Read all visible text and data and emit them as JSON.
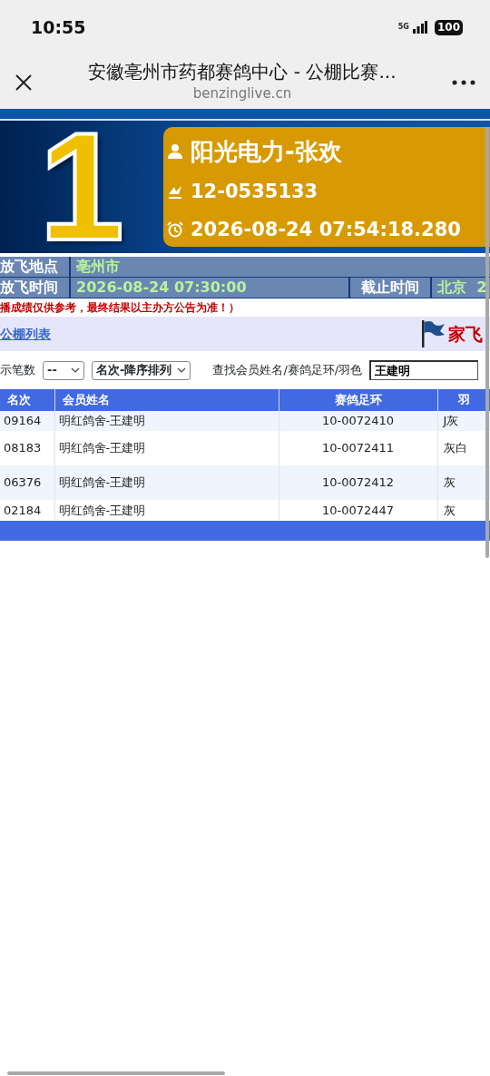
{
  "status_bar": {
    "time": "10:55",
    "network": "5G",
    "battery": "100"
  },
  "browser": {
    "title": "安徽亳州市药都赛鸽中心 - 公棚比赛...",
    "url": "benzinglive.cn"
  },
  "hero": {
    "rank": "1",
    "name": "阳光电力-张欢",
    "ring": "12-0535133",
    "time": "2026-08-24 07:54:18.280"
  },
  "info": {
    "place_label": "放飞地点",
    "place": "亳州市",
    "time_label": "放飞时间",
    "time": "2026-08-24 07:30:00",
    "deadline_label": "截止时间",
    "deadline": "北京  2"
  },
  "notice": "播成绩仅供参考，最终结果以主办方公告为准！）",
  "nav": {
    "link": "公棚列表",
    "title": "家飞"
  },
  "filters": {
    "count_label": "示笔数",
    "count_value": "--",
    "sort_value": "名次-降序排列",
    "search_label": "查找会员姓名/赛鸽足环/羽色",
    "search_value": "王建明"
  },
  "table": {
    "columns": [
      "名次",
      "会员姓名",
      "赛鸽足环",
      "羽"
    ],
    "rows": [
      [
        "09164",
        "明红鸽舍-王建明",
        "10-0072410",
        "J灰"
      ],
      [
        "08183",
        "明红鸽舍-王建明",
        "10-0072411",
        "灰白"
      ],
      [
        "06376",
        "明红鸽舍-王建明",
        "10-0072412",
        "灰"
      ],
      [
        "02184",
        "明红鸽舍-王建明",
        "10-0072447",
        "灰"
      ]
    ]
  }
}
